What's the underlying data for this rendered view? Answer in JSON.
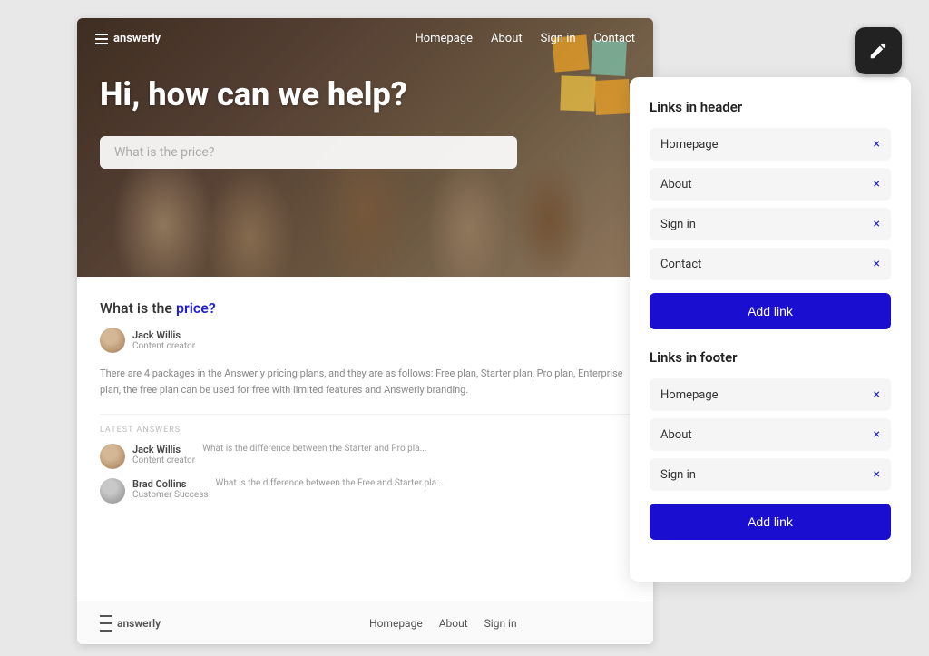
{
  "preview": {
    "hero": {
      "logo": "answerly",
      "nav": {
        "links": [
          "Homepage",
          "About",
          "Sign in",
          "Contact"
        ]
      },
      "title": "Hi, how can we help?",
      "search_placeholder": "What is the price?"
    },
    "content": {
      "question": "What is the",
      "question_highlight": "price?",
      "author": {
        "name": "Jack Willis",
        "role": "Content creator"
      },
      "body": "There are 4 packages in the Answerly pricing plans, and they are as follows: Free plan, Starter plan, Pro plan, Enterprise plan, the free plan can be used for free with limited features and Answerly branding.",
      "latest_label": "LATEST ANSWERS",
      "answers": [
        {
          "author_name": "Jack Willis",
          "author_role": "Content creator",
          "text": "What is the difference between the Starter and Pro pla..."
        },
        {
          "author_name": "Brad Collins",
          "author_role": "Customer Success",
          "text": "What is the difference between the Free and Starter pla..."
        }
      ]
    },
    "footer": {
      "logo": "answerly",
      "links": [
        "Homepage",
        "About",
        "Sign in"
      ]
    }
  },
  "panel": {
    "header_section_title": "Links in header",
    "header_links": [
      {
        "label": "Homepage"
      },
      {
        "label": "About"
      },
      {
        "label": "Sign in"
      },
      {
        "label": "Contact"
      }
    ],
    "add_link_header_label": "Add link",
    "footer_section_title": "Links in footer",
    "footer_links": [
      {
        "label": "Homepage"
      },
      {
        "label": "About"
      },
      {
        "label": "Sign in"
      }
    ],
    "add_link_footer_label": "Add link"
  },
  "icons": {
    "hamburger": "≡",
    "close": "×",
    "pencil": "✎"
  }
}
